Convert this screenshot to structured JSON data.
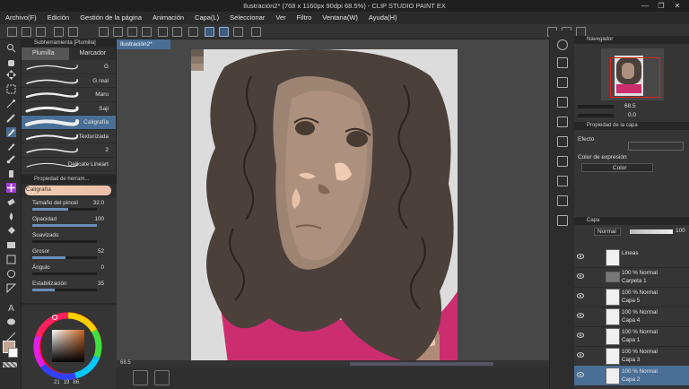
{
  "window": {
    "title": "Ilustración2* (768 x 1160px 90dpi 68.5%) - CLIP STUDIO PAINT EX",
    "controls": [
      "—",
      "❐",
      "✕"
    ]
  },
  "menu": [
    "Archivo(F)",
    "Edición",
    "Gestión de la página",
    "Animación",
    "Capa(L)",
    "Seleccionar",
    "Ver",
    "Filtro",
    "Ventana(W)",
    "Ayuda(H)"
  ],
  "subtool": {
    "header": "Subherramienta [Plumilla]",
    "tabs": [
      "Plumilla",
      "Marcador"
    ],
    "brushes": [
      "G",
      "G real",
      "Maru",
      "Saji",
      "Caligrafía",
      "Texturizada",
      "2",
      "Delicate Lineart"
    ],
    "selected_brush": "Caligrafía"
  },
  "tool_property": {
    "header": "Propiedad de herram...",
    "brush_name": "Caligrafía",
    "rows": [
      {
        "label": "Tamaño del pincel",
        "value": "32.0",
        "level": 0.55
      },
      {
        "label": "Opacidad",
        "value": "100",
        "level": 1.0
      },
      {
        "label": "Suavizado",
        "value": "",
        "level": 0
      },
      {
        "label": "Grosor",
        "value": "52",
        "level": 0.52
      },
      {
        "label": "Ángulo",
        "value": "0",
        "level": 0
      },
      {
        "label": "Estabilización",
        "value": "35",
        "level": 0.35
      }
    ]
  },
  "color": {
    "main": "#c2a48f",
    "sub": "#ffffff",
    "hsv": {
      "h": "21",
      "s": "19",
      "v": "86"
    }
  },
  "canvas": {
    "tab": "Ilustración2*",
    "zoom": "68.5",
    "bg": "#474747"
  },
  "navigator": {
    "header": "Navegador",
    "zoom": "68.5",
    "rotation": "0.0"
  },
  "layer_property": {
    "header": "Propiedad de la capa",
    "effect_label": "Efecto",
    "expression_label": "Color de expresión",
    "expression_value": "Color"
  },
  "layer_panel": {
    "header": "Capa",
    "blend": "Normal",
    "opacity": "100",
    "layers": [
      {
        "line1": "Lineas",
        "line2": "",
        "kind": "partial"
      },
      {
        "line1": "100 % Normal",
        "line2": "Carpeta 1",
        "kind": "folder"
      },
      {
        "line1": "100 % Normal",
        "line2": "Capa 5",
        "kind": "layer"
      },
      {
        "line1": "100 % Normal",
        "line2": "Capa 4",
        "kind": "layer"
      },
      {
        "line1": "100 % Normal",
        "line2": "Capa 1",
        "kind": "layer"
      },
      {
        "line1": "100 % Normal",
        "line2": "Capa 3",
        "kind": "layer"
      },
      {
        "line1": "100 % Normal",
        "line2": "Capa 2",
        "kind": "layer",
        "selected": true
      }
    ]
  }
}
